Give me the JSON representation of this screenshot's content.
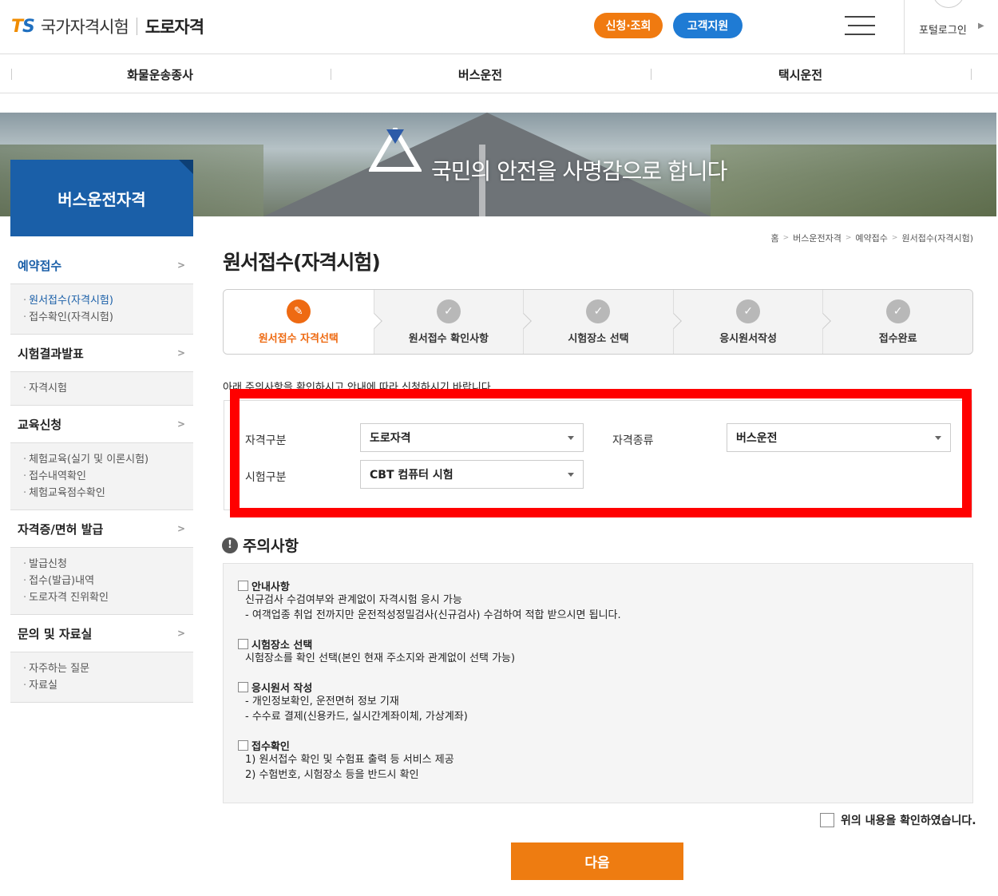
{
  "header": {
    "logo_mark": "TS",
    "logo_name": "국가자격시험",
    "logo_sub": "도로자격",
    "apply_label": "신청·조회",
    "support_label": "고객지원",
    "portal_login": "포털로그인",
    "apply_color": "#f07a10",
    "support_color": "#1f7bd4"
  },
  "topnav": {
    "items": [
      "화물운송종사",
      "버스운전",
      "택시운전"
    ]
  },
  "banner": {
    "slogan": "국민의 안전을 사명감으로 합니다"
  },
  "sidebar": {
    "title": "버스운전자격",
    "sections": [
      {
        "label": "예약접수",
        "items": [
          "원서접수(자격시험)",
          "접수확인(자격시험)"
        ]
      },
      {
        "label": "시험결과발표",
        "items": [
          "자격시험"
        ]
      },
      {
        "label": "교육신청",
        "items": [
          "체험교육(실기 및 이론시험)",
          "접수내역확인",
          "체험교육점수확인"
        ]
      },
      {
        "label": "자격증/면허 발급",
        "items": [
          "발급신청",
          "접수(발급)내역",
          "도로자격 진위확인"
        ]
      },
      {
        "label": "문의 및 자료실",
        "items": [
          "자주하는 질문",
          "자료실"
        ]
      }
    ]
  },
  "breadcrumb": [
    "홈",
    "버스운전자격",
    "예약접수",
    "원서접수(자격시험)"
  ],
  "page_title": "원서접수(자격시험)",
  "steps": [
    "원서접수 자격선택",
    "원서접수 확인사항",
    "시험장소 선택",
    "응시원서작성",
    "접수완료"
  ],
  "notice_line": "아래 주의사항을 확인하시고 안내에 따라 신청하시기 바랍니다.",
  "form": {
    "qual_category_label": "자격구분",
    "qual_category_value": "도로자격",
    "qual_type_label": "자격종류",
    "qual_type_value": "버스운전",
    "exam_type_label": "시험구분",
    "exam_type_value": "CBT 컴퓨터 시험"
  },
  "caution": {
    "title": "주의사항",
    "sections": [
      {
        "head": "안내사항",
        "lines": [
          "신규검사 수검여부와 관계없이 자격시험 응시 가능",
          "- 여객업종 취업 전까지만 운전적성정밀검사(신규검사) 수검하여 적합 받으시면 됩니다."
        ]
      },
      {
        "head": "시험장소 선택",
        "lines": [
          "시험장소를 확인 선택(본인 현재 주소지와 관계없이 선택 가능)"
        ]
      },
      {
        "head": "응시원서 작성",
        "lines": [
          "- 개인정보확인, 운전면허 정보 기재",
          "- 수수료 결제(신용카드, 실시간계좌이체, 가상계좌)"
        ]
      },
      {
        "head": "접수확인",
        "lines": [
          "1) 원서접수 확인 및 수험표 출력 등 서비스 제공",
          "2) 수험번호, 시험장소 등을 반드시 확인"
        ]
      }
    ]
  },
  "agree_label": "위의 내용을 확인하였습니다.",
  "next_label": "다음"
}
